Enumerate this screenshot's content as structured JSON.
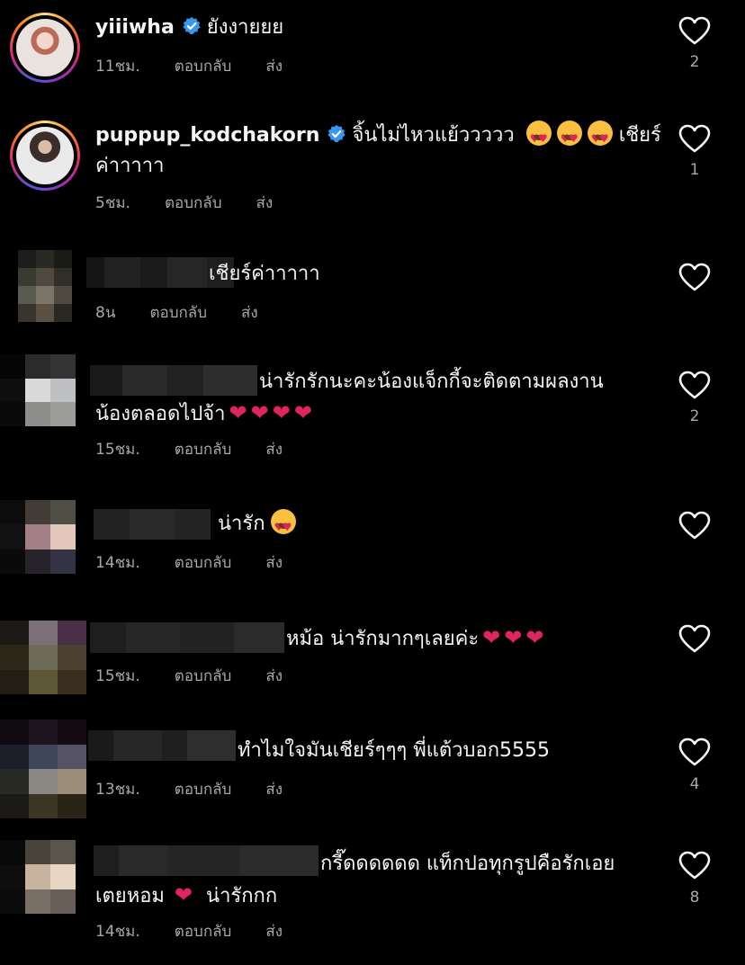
{
  "comments": [
    {
      "username": "yiiiwha",
      "verified": true,
      "text": "ยังงายยย",
      "time": "11ชม.",
      "reply": "ตอบกลับ",
      "send": "ส่ง",
      "likes": "2"
    },
    {
      "username": "puppup_kodchakorn",
      "verified": true,
      "text_line1": "จิ้นไม่ไหวแย้ววววว",
      "text_after": "เชียร์",
      "text_line2": "ค่าาาาา",
      "time": "5ชม.",
      "reply": "ตอบกลับ",
      "send": "ส่ง",
      "likes": "1"
    },
    {
      "text": "เชียร์ค่าาาาา",
      "time": "8น",
      "reply": "ตอบกลับ",
      "send": "ส่ง",
      "likes": ""
    },
    {
      "text_line1": "น่ารักรักนะคะน้องแจ็กกี้จะติดตามผลงาน",
      "text_line2": "น้องตลอดไปจ้า",
      "time": "15ชม.",
      "reply": "ตอบกลับ",
      "send": "ส่ง",
      "likes": "2"
    },
    {
      "text": "น่ารัก",
      "time": "14ชม.",
      "reply": "ตอบกลับ",
      "send": "ส่ง",
      "likes": ""
    },
    {
      "text": "หม้อ น่ารักมากๆเลยค่ะ",
      "time": "15ชม.",
      "reply": "ตอบกลับ",
      "send": "ส่ง",
      "likes": ""
    },
    {
      "text": "ทำไมใจมันเชียร์ๆๆๆ พี่แต้วบอก5555",
      "time": "13ชม.",
      "reply": "ตอบกลับ",
      "send": "ส่ง",
      "likes": "4"
    },
    {
      "text_line1": "กรี๊ดดดดดด แท็กปอทุกรูปคือรักเอย",
      "text_line2a": "เตยหอม",
      "text_line2b": "น่ารักกก",
      "time": "14ชม.",
      "reply": "ตอบกลับ",
      "send": "ส่ง",
      "likes": "8"
    }
  ],
  "colors": {
    "background": "#000000",
    "text": "#f5f5f5",
    "meta": "#a8a8a8",
    "verified": "#3897f0",
    "heart_emoji": "#e0245e"
  }
}
